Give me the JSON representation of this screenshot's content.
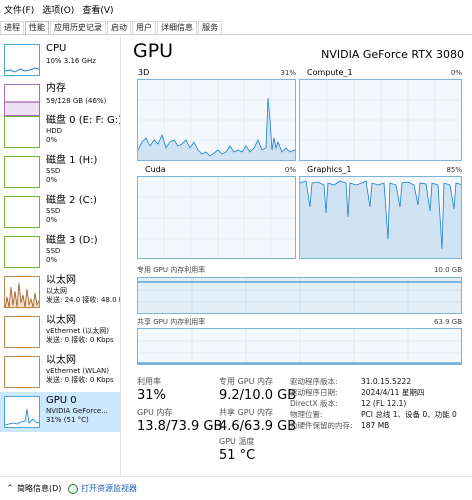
{
  "menu": [
    "文件(F)",
    "选项(O)",
    "查看(V)"
  ],
  "tabs": [
    "进程",
    "性能",
    "应用历史记录",
    "启动",
    "用户",
    "详细信息",
    "服务"
  ],
  "active_tab": "性能",
  "sidebar": [
    {
      "title": "CPU",
      "sub1": "10%  3.16 GHz",
      "sub2": "",
      "color": "#1e7fc9"
    },
    {
      "title": "内存",
      "sub1": "59/128 GB (46%)",
      "sub2": "",
      "color": "#8b3fa3"
    },
    {
      "title": "磁盘 0 (E: F: G:)",
      "sub1": "HDD",
      "sub2": "0%",
      "color": "#4e9a1d"
    },
    {
      "title": "磁盘 1 (H:)",
      "sub1": "SSD",
      "sub2": "0%",
      "color": "#4e9a1d"
    },
    {
      "title": "磁盘 2 (C:)",
      "sub1": "SSD",
      "sub2": "0%",
      "color": "#4e9a1d"
    },
    {
      "title": "磁盘 3 (D:)",
      "sub1": "SSD",
      "sub2": "0%",
      "color": "#4e9a1d"
    },
    {
      "title": "以太网",
      "sub1": "以太网",
      "sub2": "发送: 24.0  接收: 48.0 K",
      "color": "#a0581a"
    },
    {
      "title": "以太网",
      "sub1": "vEthernet (以太网)",
      "sub2": "发送: 0  接收: 0 Kbps",
      "color": "#a0581a"
    },
    {
      "title": "以太网",
      "sub1": "vEthernet (WLAN)",
      "sub2": "发送: 0  接收: 0 Kbps",
      "color": "#a0581a"
    },
    {
      "title": "GPU 0",
      "sub1": "NVIDIA GeForce...",
      "sub2": "31% (51 °C)",
      "color": "#1e7fc9"
    }
  ],
  "main": {
    "title": "GPU",
    "model": "NVIDIA GeForce RTX 3080",
    "graphs": [
      {
        "label": "3D",
        "pct": "31%"
      },
      {
        "label": "Compute_1",
        "pct": "0%"
      },
      {
        "label": "Cuda",
        "pct": "0%"
      },
      {
        "label": "Graphics_1",
        "pct": "85%"
      }
    ],
    "dedicated_mem_label": "专用 GPU 内存利用率",
    "dedicated_mem_max": "10.0 GB",
    "shared_mem_label": "共享 GPU 内存利用率",
    "shared_mem_max": "63.9 GB"
  },
  "stats": {
    "util_label": "利用率",
    "util_value": "31%",
    "gpu_mem_label": "GPU 内存",
    "gpu_mem_value": "13.8/73.9 GB",
    "ded_label": "专用 GPU 内存",
    "ded_value": "9.2/10.0 GB",
    "shared_label": "共享 GPU 内存",
    "shared_value": "4.6/63.9 GB",
    "temp_label": "GPU 温度",
    "temp_value": "51 °C"
  },
  "info": [
    {
      "k": "驱动程序版本:",
      "v": "31.0.15.5222"
    },
    {
      "k": "驱动程序日期:",
      "v": "2024/4/11    星期四"
    },
    {
      "k": "DirectX 版本:",
      "v": "12 (FL 12.1)"
    },
    {
      "k": "物理位置:",
      "v": "PCI 总线 1、设备 0、功能 0"
    },
    {
      "k": "为硬件保留的内存:",
      "v": "187 MB"
    }
  ],
  "footer": {
    "summary": "简略信息(D)",
    "open_monitor": "打开资源监视器"
  }
}
